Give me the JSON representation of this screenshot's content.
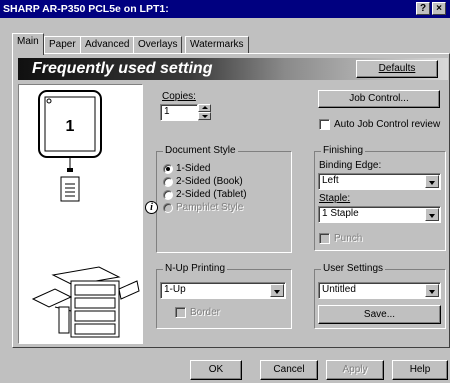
{
  "window": {
    "title": "SHARP AR-P350 PCL5e on LPT1:",
    "help_glyph": "?",
    "close_glyph": "×"
  },
  "tabs": [
    {
      "label": "Main",
      "active": true
    },
    {
      "label": "Paper",
      "active": false
    },
    {
      "label": "Advanced",
      "active": false
    },
    {
      "label": "Overlays",
      "active": false
    },
    {
      "label": "Watermarks",
      "active": false
    }
  ],
  "banner": {
    "title": "Frequently used setting",
    "defaults_label": "Defaults"
  },
  "preview": {
    "page_number": "1"
  },
  "copies": {
    "label": "Copies:",
    "value": "1"
  },
  "job_control": {
    "button_label": "Job Control...",
    "auto_review_label": "Auto Job Control review",
    "auto_review_checked": false
  },
  "document_style": {
    "title": "Document Style",
    "options": [
      {
        "label": "1-Sided",
        "selected": true,
        "enabled": true
      },
      {
        "label": "2-Sided (Book)",
        "selected": false,
        "enabled": true
      },
      {
        "label": "2-Sided (Tablet)",
        "selected": false,
        "enabled": true
      },
      {
        "label": "Pamphlet Style",
        "selected": false,
        "enabled": false
      }
    ]
  },
  "finishing": {
    "title": "Finishing",
    "binding_edge_label": "Binding Edge:",
    "binding_edge_value": "Left",
    "staple_label": "Staple:",
    "staple_value": "1 Staple",
    "punch_label": "Punch",
    "punch_enabled": false
  },
  "nup": {
    "title": "N-Up Printing",
    "value": "1-Up",
    "border_label": "Border",
    "border_enabled": false
  },
  "user_settings": {
    "title": "User Settings",
    "value": "Untitled",
    "save_label": "Save..."
  },
  "footer": {
    "ok_label": "OK",
    "cancel_label": "Cancel",
    "apply_label": "Apply",
    "help_label": "Help"
  },
  "icons": {
    "info": "info-icon",
    "printer": "printer-illustration-icon",
    "document": "document-icon"
  }
}
